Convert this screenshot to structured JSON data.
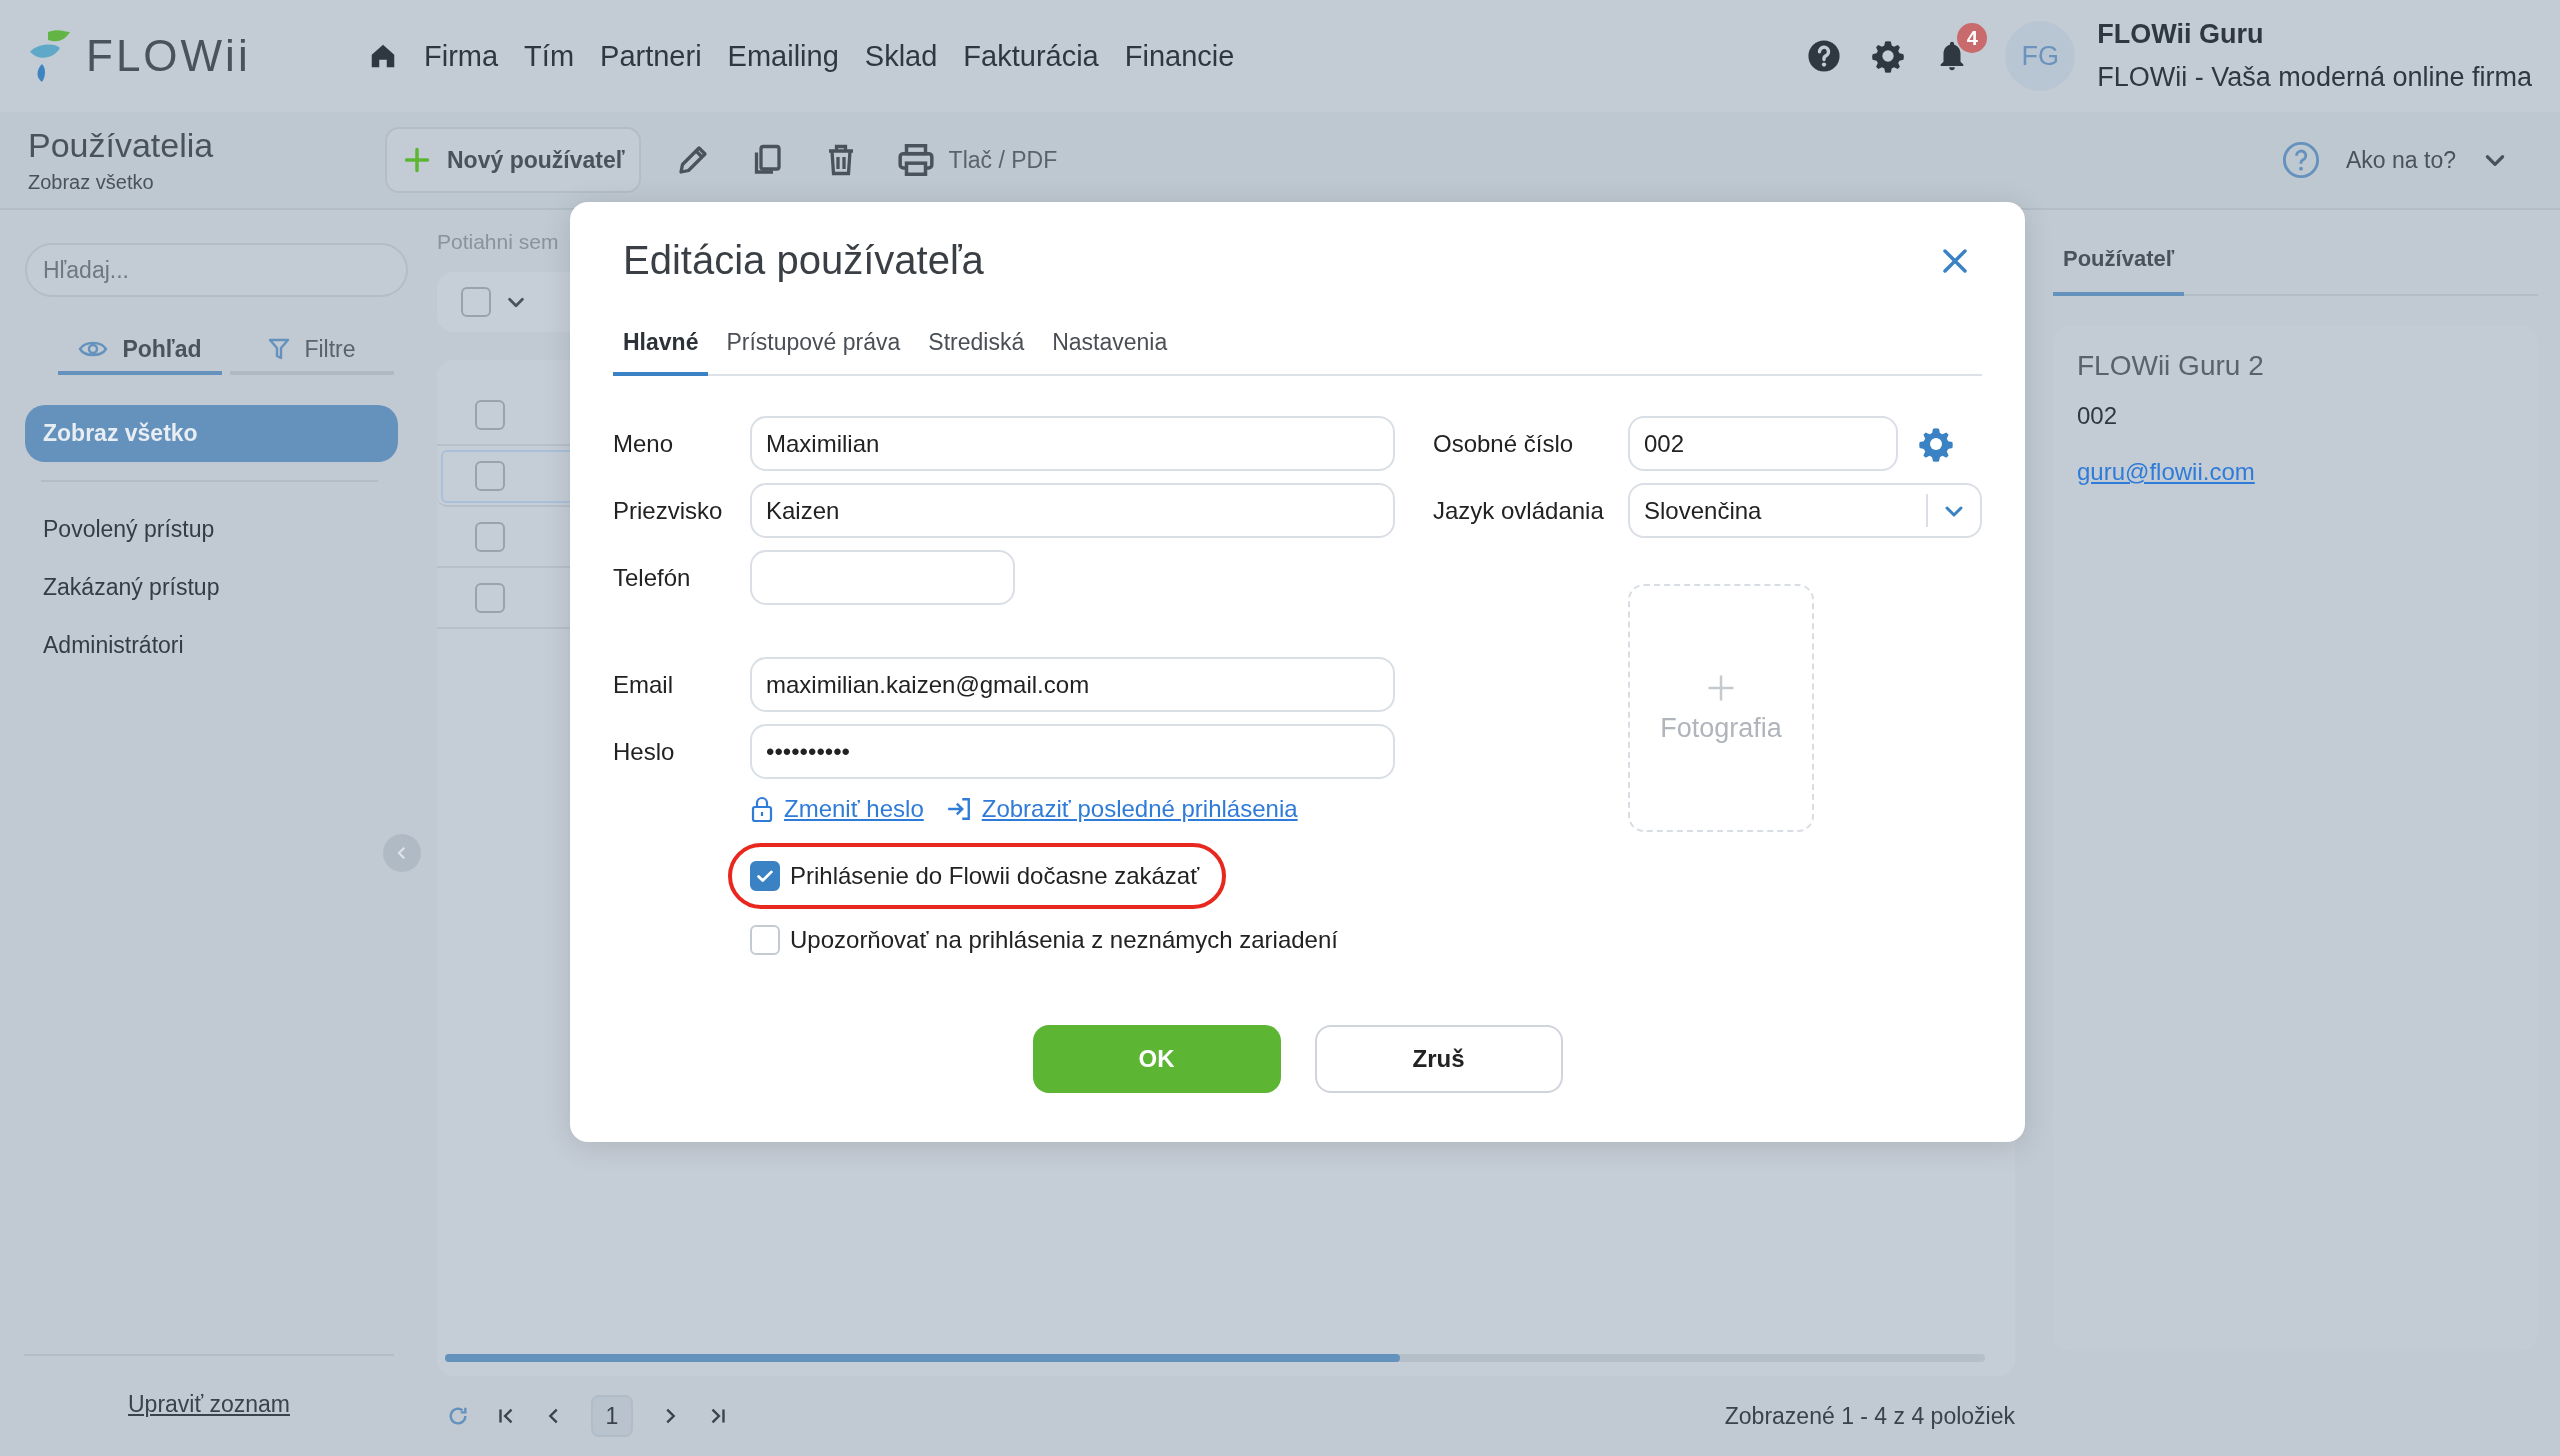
{
  "app": {
    "logo": "FLOWii",
    "nav": [
      "Firma",
      "Tím",
      "Partneri",
      "Emailing",
      "Sklad",
      "Fakturácia",
      "Financie"
    ],
    "notifications": "4"
  },
  "user": {
    "initials": "FG",
    "name": "FLOWii Guru",
    "company": "FLOWii - Vaša moderná online firma"
  },
  "page": {
    "title": "Používatelia",
    "subtitle": "Zobraz všetko"
  },
  "toolbar": {
    "new_button": "Nový používateľ",
    "print": "Tlač / PDF",
    "help": "Ako na to?"
  },
  "sidebar": {
    "search_placeholder": "Hľadaj...",
    "tabs": [
      {
        "label": "Pohľad",
        "selected": true
      },
      {
        "label": "Filtre",
        "selected": false
      }
    ],
    "items": [
      {
        "label": "Zobraz všetko",
        "selected": true
      },
      {
        "label": "Povolený prístup",
        "selected": false
      },
      {
        "label": "Zakázaný prístup",
        "selected": false
      },
      {
        "label": "Administrátori",
        "selected": false
      }
    ],
    "footer_link": "Upraviť zoznam"
  },
  "list": {
    "group_hint": "Potiahni sem",
    "header_checked": false,
    "rows": [
      {
        "checked": false,
        "selected": false
      },
      {
        "checked": false,
        "selected": true
      },
      {
        "checked": false,
        "selected": false
      },
      {
        "checked": false,
        "selected": false
      }
    ]
  },
  "pagination": {
    "page": "1",
    "summary": "Zobrazené 1 - 4 z 4 položiek"
  },
  "detail": {
    "tab": "Používateľ",
    "name": "FLOWii Guru 2",
    "number": "002",
    "email": "guru@flowii.com"
  },
  "dialog": {
    "title": "Editácia používateľa",
    "tabs": [
      {
        "label": "Hlavné",
        "selected": true
      },
      {
        "label": "Prístupové práva",
        "selected": false
      },
      {
        "label": "Strediská",
        "selected": false
      },
      {
        "label": "Nastavenia",
        "selected": false
      }
    ],
    "left_fields": [
      {
        "label": "Meno",
        "kind": "text",
        "value": "Maximilian"
      },
      {
        "label": "Priezvisko",
        "kind": "text",
        "value": "Kaizen"
      },
      {
        "label": "Telefón",
        "kind": "short"
      },
      {
        "label": "Email",
        "kind": "text",
        "value": "maximilian.kaizen@gmail.com"
      },
      {
        "label": "Heslo",
        "kind": "password",
        "value": "••••••••••"
      }
    ],
    "links": [
      "Zmeniť heslo",
      "Zobraziť posledné prihlásenia"
    ],
    "checkboxes": [
      {
        "label": "Prihlásenie do Flowii dočasne zakázať",
        "checked": true,
        "highlighted": true
      },
      {
        "label": "Upozorňovať na prihlásenia z neznámych zariadení",
        "checked": false,
        "highlighted": false
      }
    ],
    "right_fields": [
      {
        "label": "Osobné číslo",
        "kind": "text",
        "value": "002"
      },
      {
        "label": "Jazyk ovládania",
        "kind": "select",
        "value": "Slovenčina"
      }
    ],
    "photo": "Fotografia",
    "buttons": [
      {
        "label": "OK",
        "kind": "primary"
      },
      {
        "label": "Zruš",
        "kind": "secondary"
      }
    ]
  }
}
